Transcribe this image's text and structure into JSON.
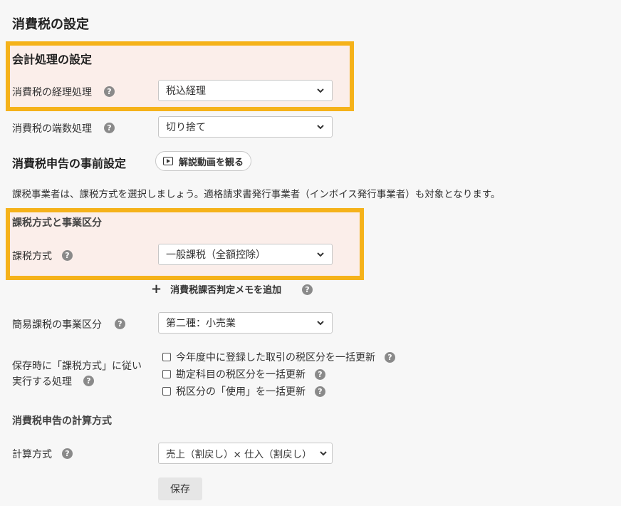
{
  "page_title": "消費税の設定",
  "accounting_section": {
    "title": "会計処理の設定",
    "tax_accounting_label": "消費税の経理処理",
    "tax_accounting_value": "税込経理",
    "rounding_label": "消費税の端数処理",
    "rounding_value": "切り捨て"
  },
  "pre_filing": {
    "title": "消費税申告の事前設定",
    "video_button": "解説動画を観る",
    "description": "課税事業者は、課税方式を選択しましょう。適格請求書発行事業者（インボイス発行事業者）も対象となります。"
  },
  "tax_method_section": {
    "title": "課税方式と事業区分",
    "method_label": "課税方式",
    "method_value": "一般課税（全額控除）"
  },
  "add_memo_label": "消費税課否判定メモを追加",
  "simplified": {
    "label": "簡易課税の事業区分",
    "value": "第二種：小売業"
  },
  "on_save": {
    "label_line1": "保存時に「課税方式」に従い",
    "label_line2": "実行する処理",
    "options": [
      "今年度中に登録した取引の税区分を一括更新",
      "勘定科目の税区分を一括更新",
      "税区分の「使用」を一括更新"
    ]
  },
  "calc_section": {
    "title": "消費税申告の計算方式",
    "label": "計算方式",
    "value": "売上（割戻し）× 仕入（割戻し）"
  },
  "save_button": "保存",
  "help_glyph": "?",
  "colors": {
    "highlight_border": "#f5b21a",
    "highlight_bg": "#fbeeea",
    "background": "#f7f7f7"
  }
}
